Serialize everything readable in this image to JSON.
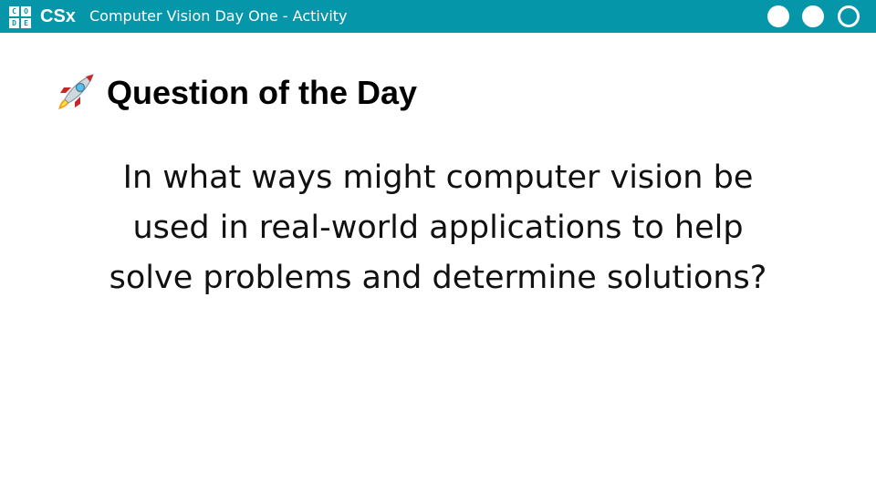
{
  "header": {
    "logo_letters": [
      "C",
      "O",
      "D",
      "E"
    ],
    "brand": "CSx",
    "course_title": "Computer Vision Day One - Activity",
    "progress_dots": [
      "filled",
      "filled",
      "outline"
    ],
    "bar_color": "#0596a9"
  },
  "slide": {
    "heading_icon": "rocket-icon",
    "heading": "Question of the Day",
    "question_lines": [
      "In what ways might computer vision be",
      "used in real-world applications to help",
      "solve problems and determine solutions?"
    ]
  }
}
